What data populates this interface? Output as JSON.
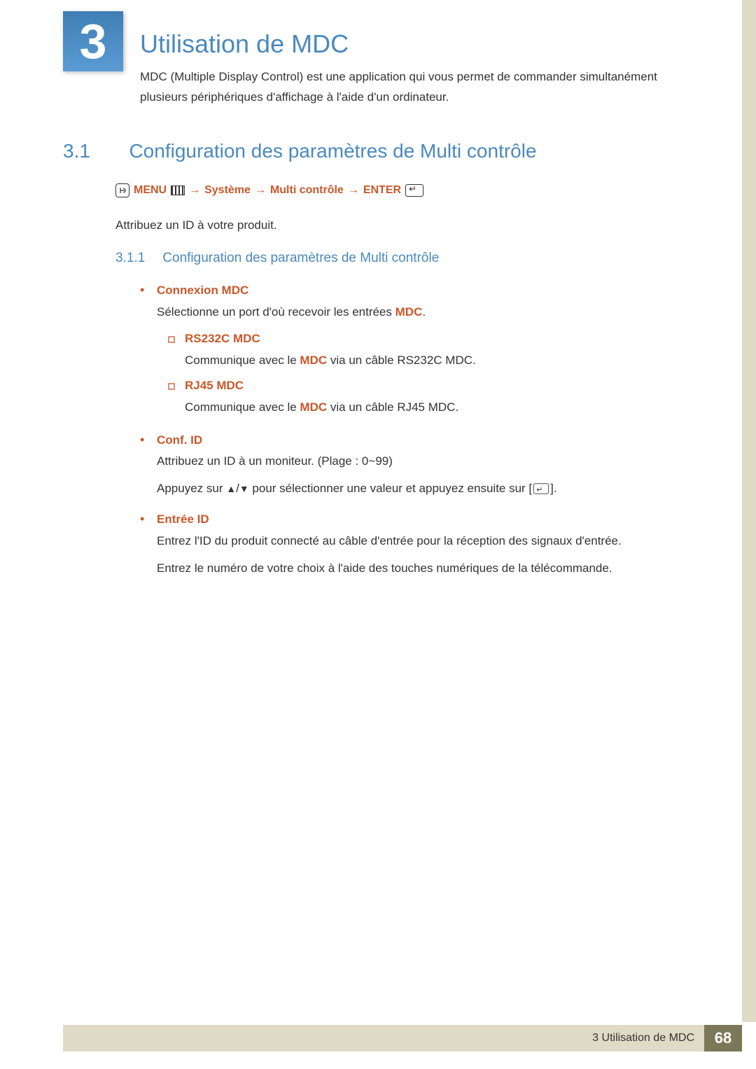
{
  "chapter": {
    "number": "3",
    "title": "Utilisation de MDC"
  },
  "intro": "MDC (Multiple Display Control) est une application qui vous permet de commander simultanément plusieurs périphériques d'affichage à l'aide d'un ordinateur.",
  "section": {
    "number": "3.1",
    "title": "Configuration des paramètres de Multi contrôle"
  },
  "navpath": {
    "menu": "MENU",
    "sys": "Système",
    "multi": "Multi contrôle",
    "enter": "ENTER",
    "arrow": "→"
  },
  "assign": "Attribuez un ID à votre produit.",
  "subsection": {
    "number": "3.1.1",
    "title": "Configuration des paramètres de Multi contrôle"
  },
  "items": {
    "connexion": {
      "label": "Connexion MDC",
      "desc_a": "Sélectionne un port d'où recevoir les entrées ",
      "desc_b": "MDC",
      "desc_c": ".",
      "sub": {
        "rs": {
          "label": "RS232C MDC",
          "desc_a": "Communique avec le ",
          "desc_b": "MDC",
          "desc_c": " via un câble RS232C MDC."
        },
        "rj": {
          "label": "RJ45 MDC",
          "desc_a": "Communique avec le ",
          "desc_b": "MDC",
          "desc_c": " via un câble RJ45 MDC."
        }
      }
    },
    "confid": {
      "label": "Conf. ID",
      "line1": "Attribuez un ID à un moniteur. (Plage : 0~99)",
      "line2_a": "Appuyez sur ",
      "line2_b": " pour sélectionner une valeur et appuyez ensuite sur [",
      "line2_c": "]."
    },
    "entree": {
      "label": "Entrée ID",
      "line1": "Entrez l'ID du produit connecté au câble d'entrée pour la réception des signaux d'entrée.",
      "line2": "Entrez le numéro de votre choix à l'aide des touches numériques de la télécommande."
    }
  },
  "footer": {
    "chapter_label": "3 Utilisation de MDC",
    "page": "68"
  }
}
